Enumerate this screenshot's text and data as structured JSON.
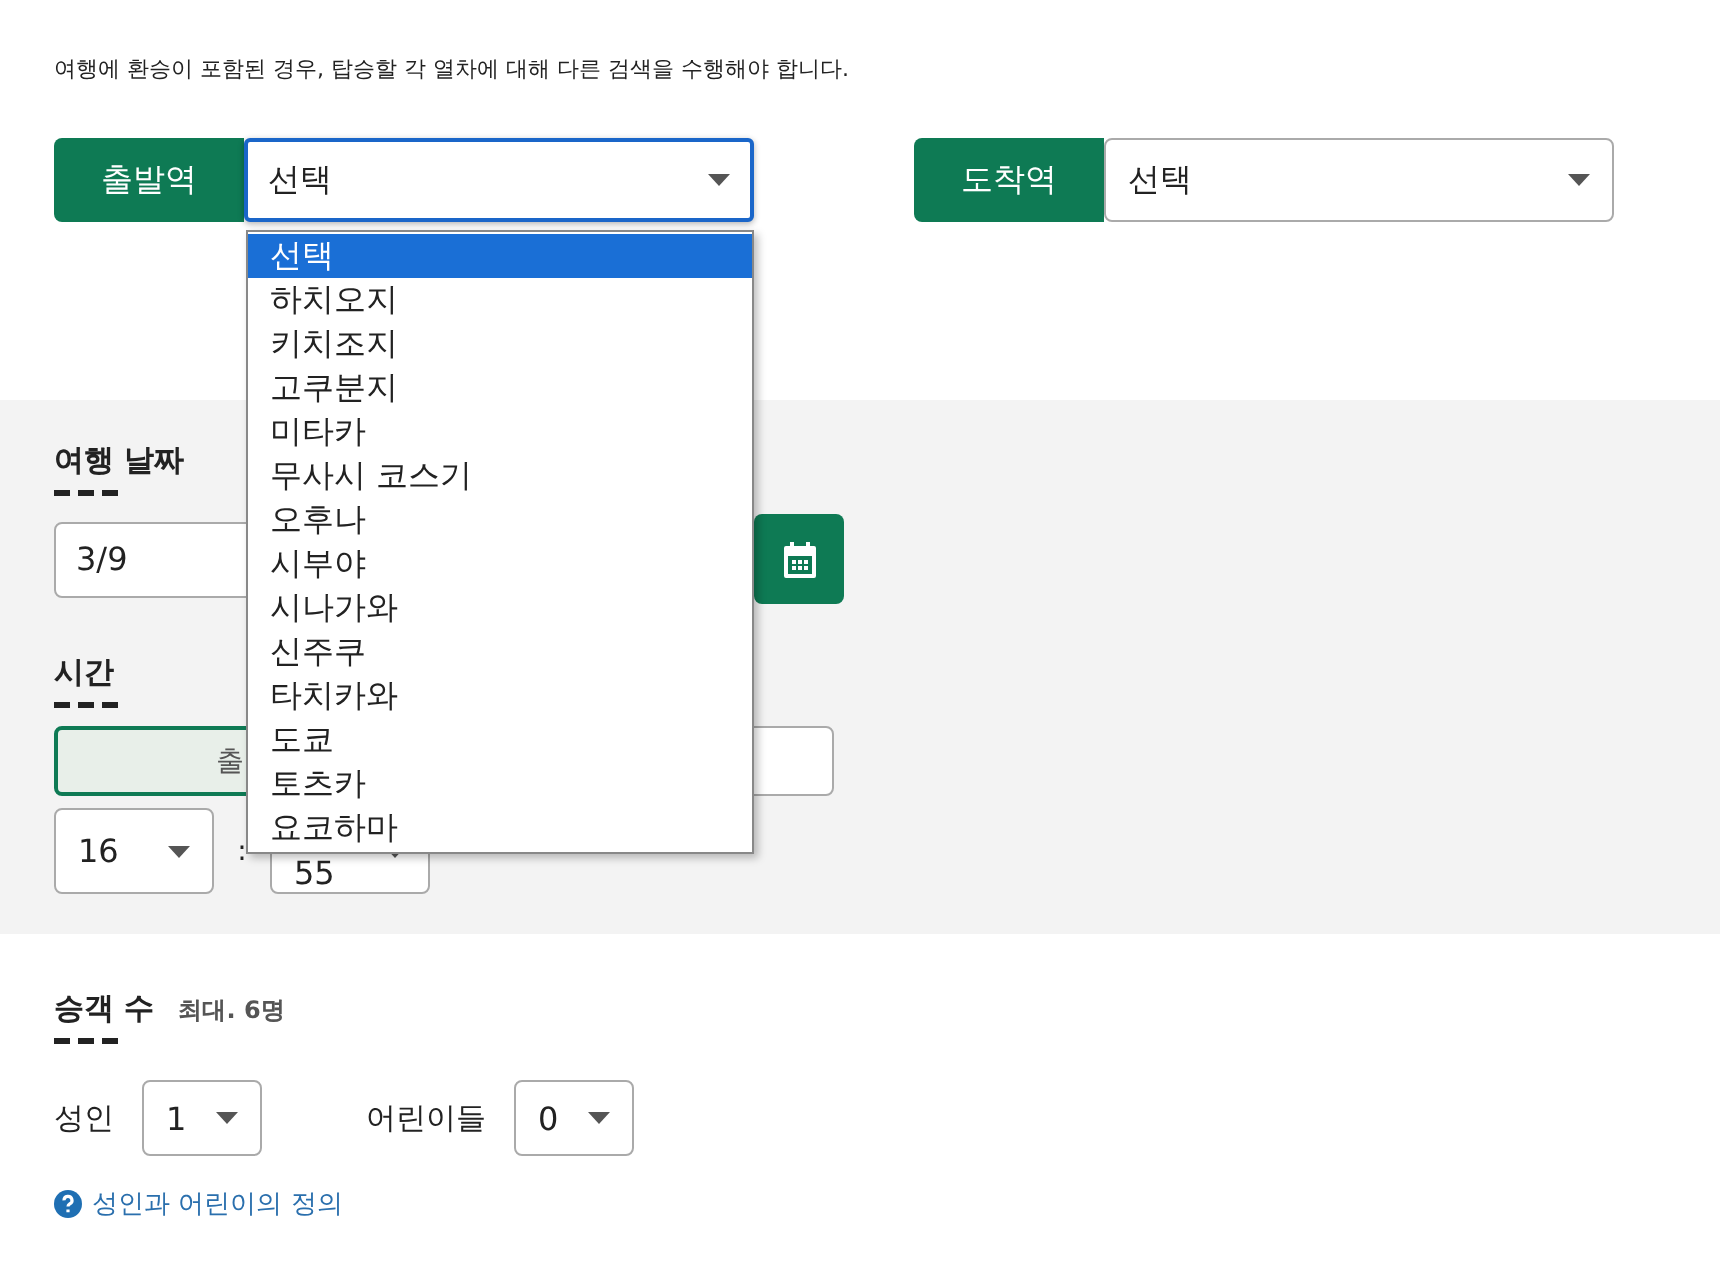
{
  "notice": "여행에 환승이 포함된 경우, 탑승할 각 열차에 대해 다른 검색을 수행해야 합니다.",
  "stations": [
    {
      "label": "출발역",
      "value": "선택",
      "focused": true,
      "open": true,
      "options": [
        {
          "label": "선택",
          "selected": true
        },
        {
          "label": "하치오지",
          "selected": false
        },
        {
          "label": "키치조지",
          "selected": false
        },
        {
          "label": "고쿠분지",
          "selected": false
        },
        {
          "label": "미타카",
          "selected": false
        },
        {
          "label": "무사시 코스기",
          "selected": false
        },
        {
          "label": "오후나",
          "selected": false
        },
        {
          "label": "시부야",
          "selected": false
        },
        {
          "label": "시나가와",
          "selected": false
        },
        {
          "label": "신주쿠",
          "selected": false
        },
        {
          "label": "타치카와",
          "selected": false
        },
        {
          "label": "도쿄",
          "selected": false
        },
        {
          "label": "토츠카",
          "selected": false
        },
        {
          "label": "요코하마",
          "selected": false
        }
      ]
    },
    {
      "label": "도착역",
      "value": "선택",
      "focused": false,
      "open": false
    }
  ],
  "trip_date": {
    "heading": "여행 날짜",
    "value": "3/9"
  },
  "time": {
    "heading": "시간",
    "modes": [
      {
        "label": "출",
        "selected": true
      },
      {
        "selected": false
      }
    ],
    "hour": "16",
    "separator": ":",
    "minute": "55"
  },
  "passengers": {
    "heading": "승객 수",
    "note": "최대. 6명",
    "groups": [
      {
        "label": "성인",
        "value": "1"
      },
      {
        "label": "어린이들",
        "value": "0"
      }
    ]
  },
  "help_link": "성인과 어린이의 정의"
}
